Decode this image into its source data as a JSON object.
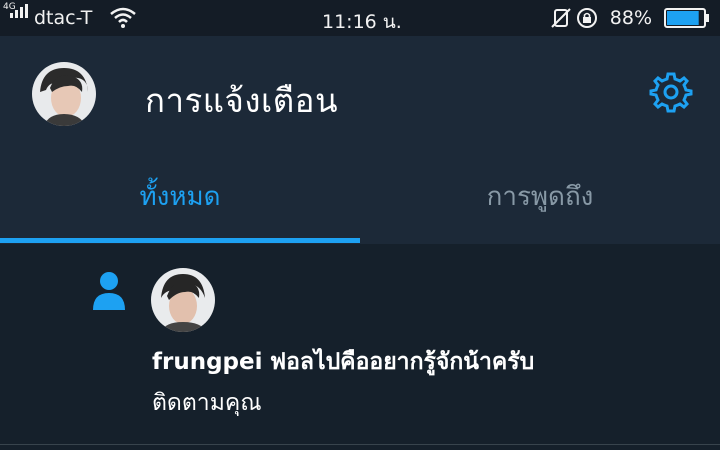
{
  "status_bar": {
    "network_type": "4G",
    "carrier": "dtac-T",
    "time": "11:16 น.",
    "battery_percent": "88%",
    "battery_level": 0.88,
    "icons": [
      "signal-icon",
      "wifi-icon",
      "mute-icon",
      "rotation-lock-icon",
      "battery-icon"
    ]
  },
  "header": {
    "title": "การแจ้งเตือน",
    "settings_icon": "gear-icon"
  },
  "tabs": [
    {
      "label": "ทั้งหมด",
      "active": true
    },
    {
      "label": "การพูดถึง",
      "active": false
    }
  ],
  "notifications": [
    {
      "type_icon": "person-icon",
      "username": "frungpei",
      "display_text": "ฟอลไปคืออยากรู้จักน้าครับ",
      "action": "ติดตามคุณ"
    }
  ],
  "colors": {
    "accent": "#1da1f2",
    "background": "#15202b",
    "header_background": "#1c2938",
    "inactive_tab": "#8899a6"
  }
}
